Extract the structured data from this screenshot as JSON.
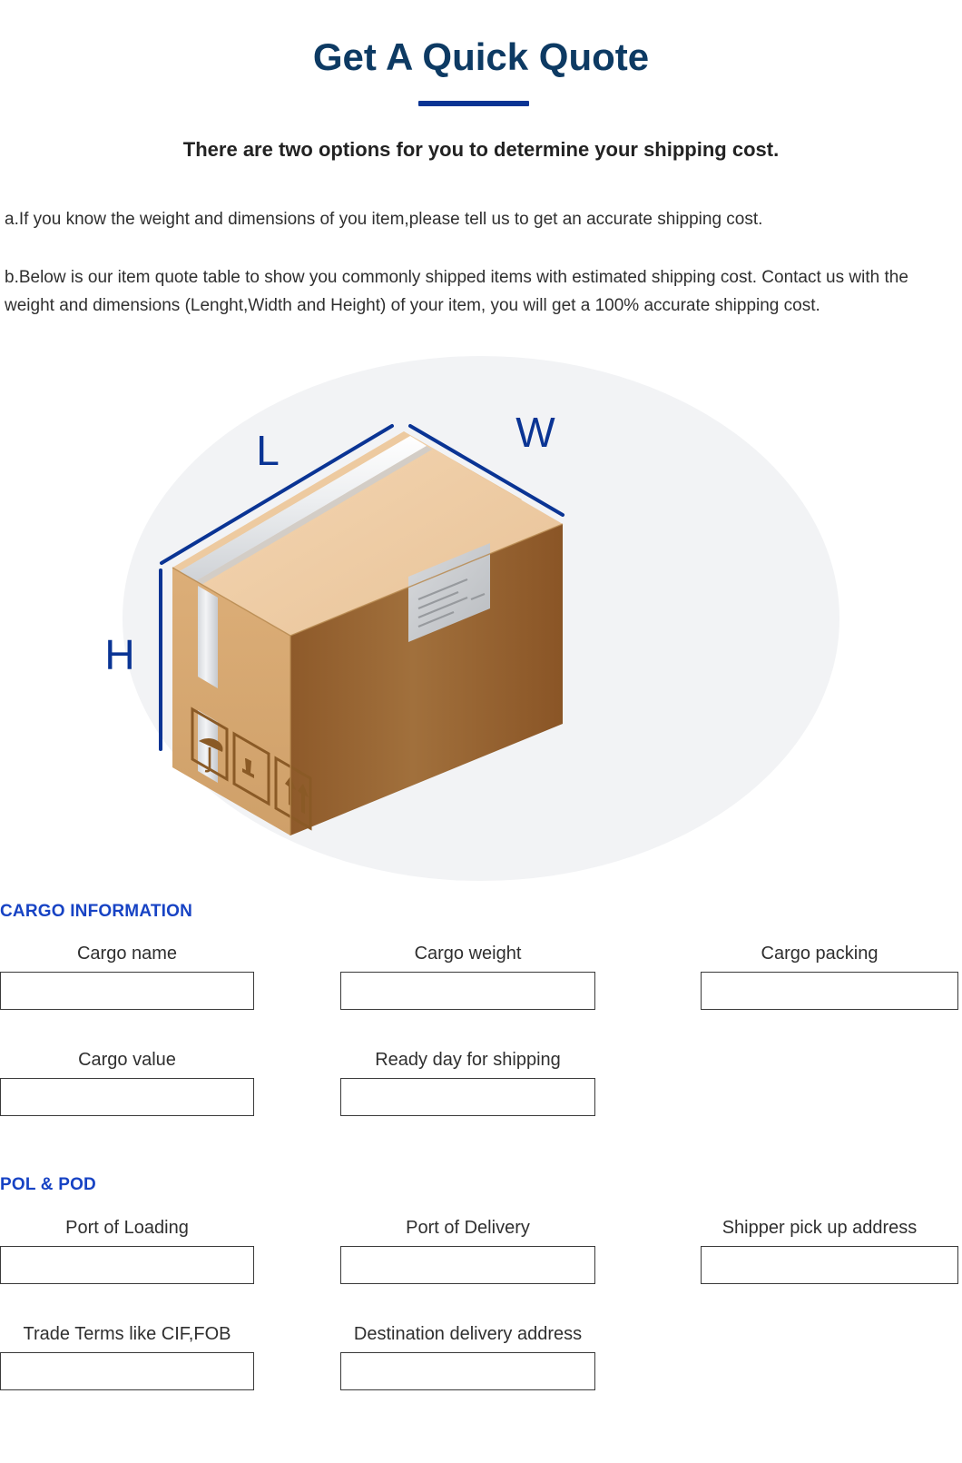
{
  "header": {
    "title": "Get A Quick Quote",
    "subtitle": "There are two options for you to determine your shipping cost.",
    "accent_color": "#0d3a63",
    "rule_color": "#0a3494"
  },
  "intro": {
    "option_a": "a.If you know the weight and dimensions of you item,please tell us to get an accurate shipping cost.",
    "option_b": "b.Below is our item quote table to show you commonly shipped items with estimated shipping cost. Contact us with the weight and dimensions (Lenght,Width and Height) of your item, you will get a 100% accurate shipping cost."
  },
  "illustration": {
    "name": "carton-box-dimensions-diagram",
    "backdrop_color": "#f2f3f5",
    "dimension_label_color": "#0a3494",
    "labels": {
      "length": "L",
      "width": "W",
      "height": "H"
    },
    "box_colors": {
      "top_flap_light": "#f0cfa8",
      "top_flap_mid": "#e8bf93",
      "left_face": "#d8a871",
      "right_face": "#9a6632",
      "tape": "#e6e7e9",
      "label": "#c9cbcd",
      "symbol_ink": "#8a5a26"
    },
    "handling_symbols": [
      "umbrella-keep-dry-icon",
      "fragile-glass-icon",
      "this-way-up-arrows-icon"
    ]
  },
  "cargo_section": {
    "heading": "CARGO INFORMATION",
    "fields": [
      {
        "label": "Cargo name",
        "value": "",
        "placeholder": ""
      },
      {
        "label": "Cargo weight",
        "value": "",
        "placeholder": ""
      },
      {
        "label": "Cargo packing",
        "value": "",
        "placeholder": ""
      },
      {
        "label": "Cargo value",
        "value": "",
        "placeholder": ""
      },
      {
        "label": "Ready day  for shipping",
        "value": "",
        "placeholder": ""
      }
    ]
  },
  "pol_pod_section": {
    "heading": "POL & POD",
    "fields": [
      {
        "label": "Port of Loading",
        "value": "",
        "placeholder": ""
      },
      {
        "label": "Port of Delivery",
        "value": "",
        "placeholder": ""
      },
      {
        "label": "Shipper pick up address",
        "value": "",
        "placeholder": ""
      },
      {
        "label": "Trade Terms like CIF,FOB",
        "value": "",
        "placeholder": ""
      },
      {
        "label": "Destination delivery address",
        "value": "",
        "placeholder": ""
      }
    ]
  }
}
